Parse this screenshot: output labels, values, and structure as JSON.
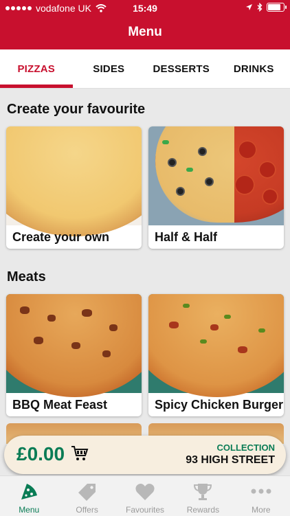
{
  "status": {
    "carrier": "vodafone UK",
    "time": "15:49"
  },
  "header": {
    "title": "Menu"
  },
  "tabs": [
    {
      "label": "PIZZAS",
      "active": true
    },
    {
      "label": "SIDES"
    },
    {
      "label": "DESSERTS"
    },
    {
      "label": "DRINKS"
    }
  ],
  "sections": [
    {
      "title": "Create your favourite",
      "items": [
        {
          "label": "Create your own"
        },
        {
          "label": "Half & Half"
        }
      ]
    },
    {
      "title": "Meats",
      "items": [
        {
          "label": "BBQ Meat Feast"
        },
        {
          "label": "Spicy Chicken Burger"
        }
      ]
    }
  ],
  "basket": {
    "price": "£0.00",
    "mode_label": "COLLECTION",
    "store": "93 HIGH STREET"
  },
  "nav": [
    {
      "label": "Menu",
      "icon": "pizza-slice-icon",
      "active": true
    },
    {
      "label": "Offers",
      "icon": "tag-icon"
    },
    {
      "label": "Favourites",
      "icon": "heart-icon"
    },
    {
      "label": "Rewards",
      "icon": "trophy-icon"
    },
    {
      "label": "More",
      "icon": "more-dots-icon"
    }
  ],
  "colors": {
    "brand_red": "#c8102e",
    "accent_green": "#0a7c55"
  }
}
